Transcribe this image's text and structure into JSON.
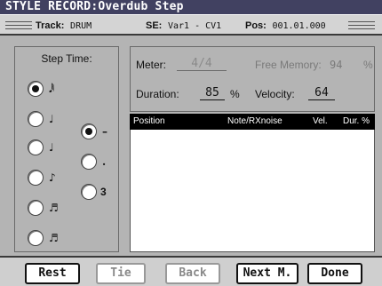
{
  "title": "STYLE RECORD:Overdub Step",
  "status": {
    "track_label": "Track:",
    "track_value": "DRUM",
    "se_label": "SE:",
    "se_value": "Var1 - CV1",
    "pos_label": "Pos:",
    "pos_value": "001.01.000"
  },
  "step_time": {
    "label": "Step Time:",
    "note_glyphs": [
      "𝅘𝅥𝅱",
      "♩",
      "♩",
      "♪",
      "♬",
      "♬"
    ],
    "selected_index": 0,
    "modifiers": [
      "–",
      ".",
      "3"
    ],
    "selected_modifier": 0
  },
  "meter": {
    "label": "Meter:",
    "value": "4/4"
  },
  "free_memory": {
    "label": "Free Memory:",
    "value": "94",
    "unit": "%"
  },
  "duration": {
    "label": "Duration:",
    "value": "85",
    "unit": "%"
  },
  "velocity": {
    "label": "Velocity:",
    "value": "64"
  },
  "table": {
    "columns": [
      "Position",
      "Note/RXnoise",
      "Vel.",
      "Dur. %"
    ],
    "rows": []
  },
  "buttons": {
    "rest": "Rest",
    "tie": "Tie",
    "back": "Back",
    "next": "Next M.",
    "done": "Done"
  }
}
